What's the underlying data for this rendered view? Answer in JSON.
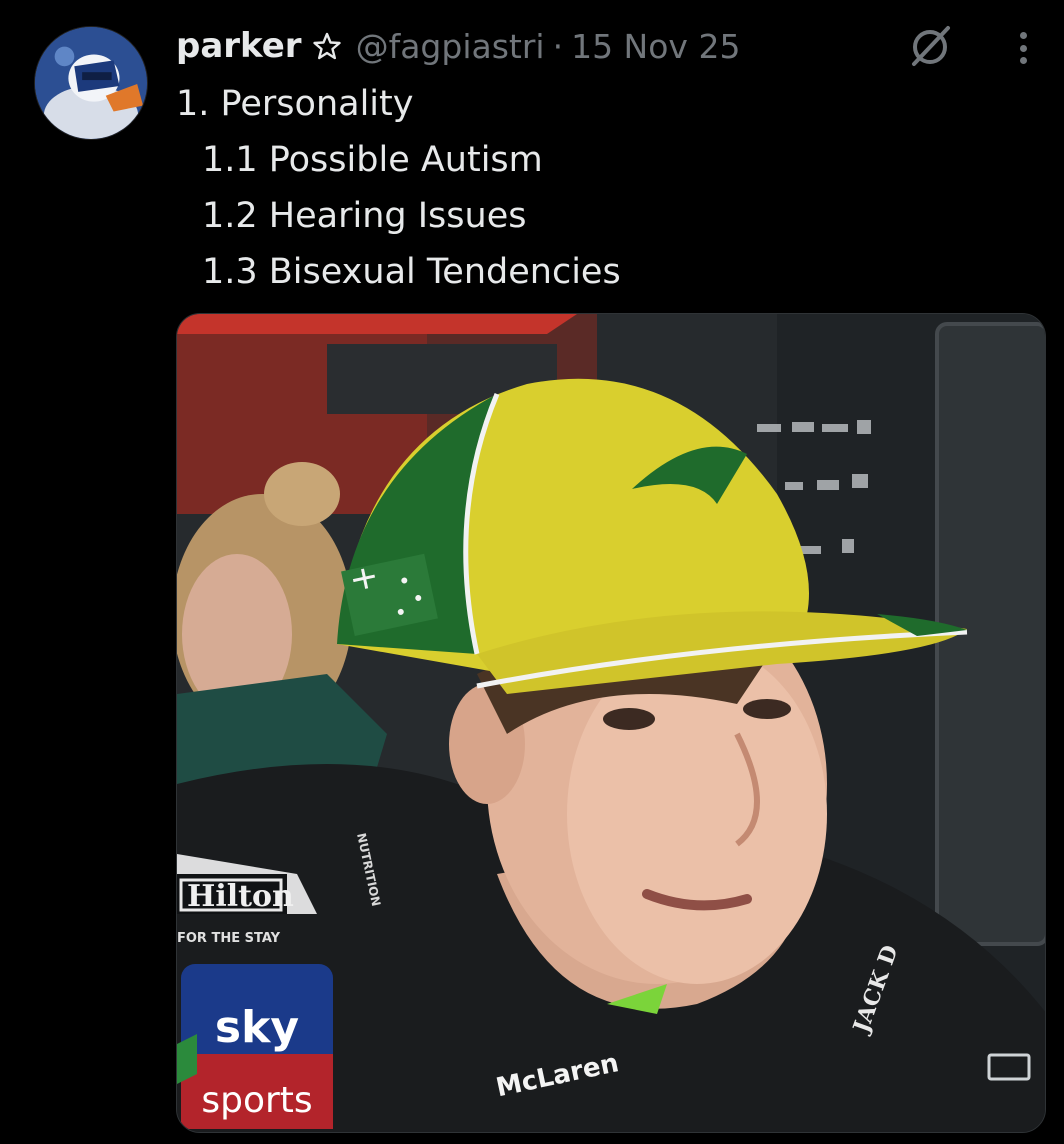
{
  "post": {
    "author_name": "parker",
    "author_handle": "@fagpiastri",
    "separator": "·",
    "date": "15 Nov 25",
    "text_lines": [
      "1. Personality",
      "1.1 Possible Autism",
      "1.2 Hearing Issues",
      "1.3 Bisexual Tendencies"
    ]
  },
  "media": {
    "overlay_text": {
      "sponsor_left": "Hilton",
      "sponsor_left_sub": "FOR THE STAY",
      "broadcaster_top": "sky",
      "broadcaster_bottom": "sports",
      "team_logo": "McLaren",
      "sponsor_right": "JACK D",
      "sleeve_text": "NUTRITION"
    }
  },
  "icons": {
    "verified_star": "star-outline-icon",
    "grok": "grok-slash-icon",
    "more": "more-vertical-icon",
    "alt": "media-rect-icon"
  },
  "colors": {
    "background": "#000000",
    "primary_text": "#e7e9ea",
    "secondary_text": "#71767b",
    "cap_yellow": "#d9cf2e",
    "cap_green": "#1f6b2c"
  }
}
